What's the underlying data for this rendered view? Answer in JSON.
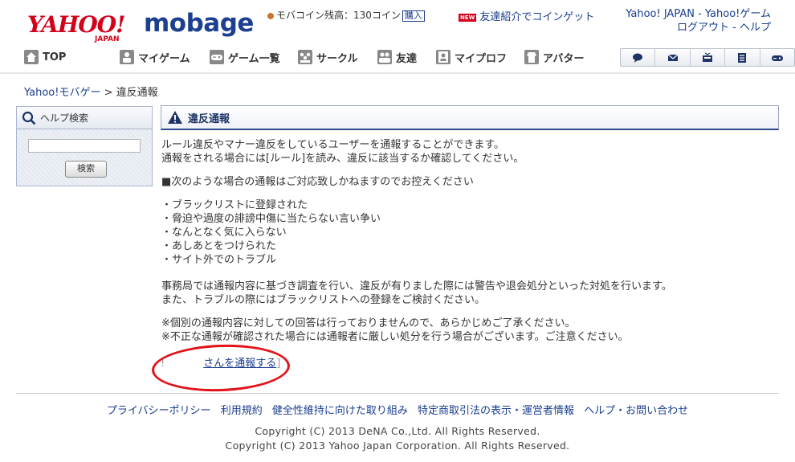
{
  "brand": {
    "yahoo": "YAHOO!",
    "japan": "JAPAN",
    "mobage": "mobage"
  },
  "header": {
    "coin_text": "モバコイン残高：130コイン",
    "buy_label": "購入",
    "new_badge": "NEW",
    "invite_text": "友達紹介でコインゲット",
    "top_links": "Yahoo! JAPAN - Yahoo!ゲーム",
    "account_links": "ログアウト - ヘルプ"
  },
  "nav": {
    "items": [
      {
        "label": "TOP",
        "icon": "home-icon"
      },
      {
        "label": "マイゲーム",
        "icon": "my-game-icon"
      },
      {
        "label": "ゲーム一覧",
        "icon": "gamepad-icon"
      },
      {
        "label": "サークル",
        "icon": "circle-icon"
      },
      {
        "label": "友達",
        "icon": "friends-icon"
      },
      {
        "label": "マイプロフ",
        "icon": "profile-icon"
      },
      {
        "label": "アバター",
        "icon": "avatar-icon"
      }
    ],
    "quick_icons": [
      "chat-icon",
      "mail-icon",
      "inbox-icon",
      "notes-icon",
      "game-controller-icon"
    ]
  },
  "breadcrumb": {
    "root": "Yahoo!モバゲー",
    "separator": ">",
    "current": "違反通報"
  },
  "help": {
    "title": "ヘルプ検索",
    "input_value": "",
    "button_label": "検索"
  },
  "main": {
    "title": "違反通報",
    "intro_1": "ルール違反やマナー違反をしているユーザーを通報することができます。",
    "intro_2": "通報をされる場合には[ルール]を読み、違反に該当するか確認してください。",
    "notice_heading": "■次のような場合の通報はご対応致しかねますのでお控えください",
    "cases": [
      "・ブラックリストに登録された",
      "・脅迫や過度の誹謗中傷に当たらない言い争い",
      "・なんとなく気に入らない",
      "・あしあとをつけられた",
      "・サイト外でのトラブル"
    ],
    "process_1": "事務局では通報内容に基づき調査を行い、違反が有りました際には警告や退会処分といった対処を行います。",
    "process_2": "また、トラブルの際にはブラックリストへの登録をご検討ください。",
    "note_1": "※個別の通報内容に対しての回答は行っておりませんので、あらかじめご了承ください。",
    "note_2": "※不正な通報が確認された場合には通報者に厳しい処分を行う場合がございます。ご注意ください。",
    "report_prefix": "!",
    "report_link": "さんを通報する",
    "report_suffix": "]"
  },
  "footer": {
    "links": [
      "プライバシーポリシー",
      "利用規約",
      "健全性維持に向けた取り組み",
      "特定商取引法の表示・運営者情報",
      "ヘルプ・お問い合わせ"
    ],
    "copyright_1": "Copyright (C) 2013 DeNA Co.,Ltd. All Rights Reserved.",
    "copyright_2": "Copyright (C) 2013 Yahoo Japan Corporation. All Rights Reserved."
  },
  "colors": {
    "brand_red": "#d4001a",
    "brand_blue": "#1d3f8f",
    "link": "#1a3d8f",
    "annotation_red": "#e0141a"
  }
}
